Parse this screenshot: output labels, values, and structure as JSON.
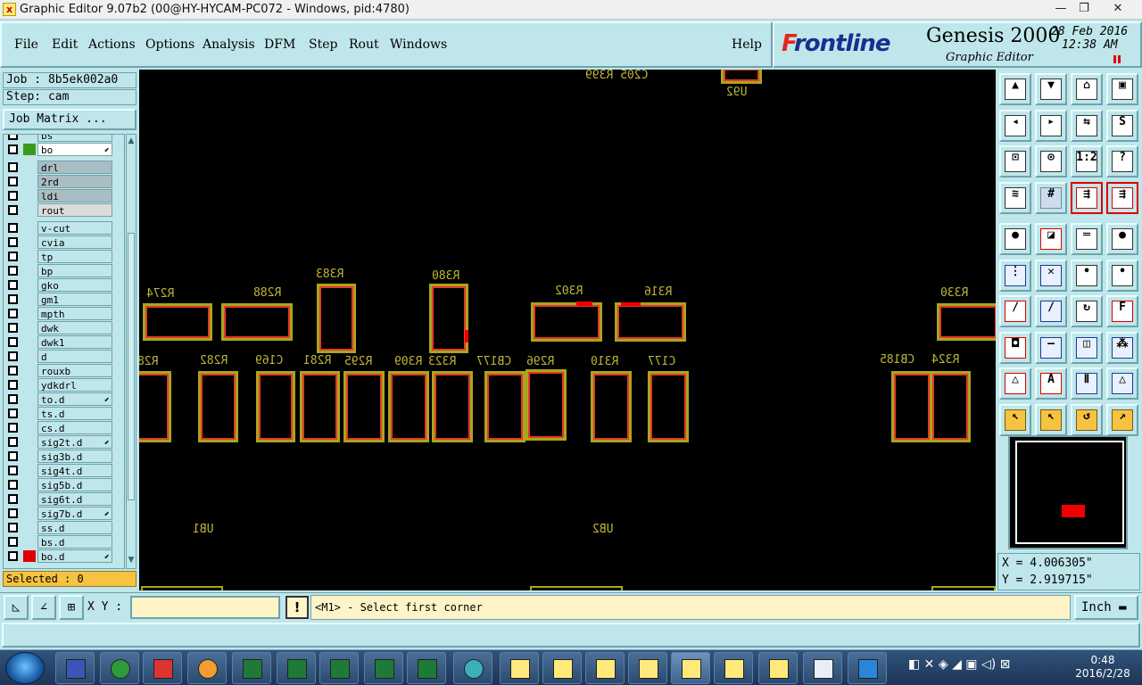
{
  "window": {
    "title": "Graphic Editor 9.07b2 (00@HY-HYCAM-PC072 - Windows, pid:4780)",
    "minimize": "—",
    "maximize": "❐",
    "close": "✕"
  },
  "menu": {
    "file": "File",
    "edit": "Edit",
    "actions": "Actions",
    "options": "Options",
    "analysis": "Analysis",
    "dfm": "DFM",
    "step": "Step",
    "rout": "Rout",
    "windows": "Windows",
    "help": "Help"
  },
  "brand": {
    "logo_first": "F",
    "logo_rest": "rontline",
    "product": "Genesis 2000",
    "subtitle": "Graphic Editor",
    "date": "28 Feb 2016",
    "time": "12:38 AM"
  },
  "job": {
    "job_line": "Job : 8b5ek002a0",
    "step_line": "Step: cam",
    "matrix_button": "Job Matrix ...",
    "selected": "Selected : 0"
  },
  "layers": [
    {
      "name": "bs"
    },
    {
      "name": "bo",
      "swatch": "#3a9a1a",
      "style": "white",
      "arrow": true
    },
    {
      "name": "drl",
      "style": "gray"
    },
    {
      "name": "2rd",
      "style": "gray"
    },
    {
      "name": "ldi",
      "style": "gray"
    },
    {
      "name": "rout",
      "style": "light"
    },
    {
      "name": "v-cut"
    },
    {
      "name": "cvia"
    },
    {
      "name": "tp"
    },
    {
      "name": "bp"
    },
    {
      "name": "gko"
    },
    {
      "name": "gm1"
    },
    {
      "name": "mpth"
    },
    {
      "name": "dwk"
    },
    {
      "name": "dwk1"
    },
    {
      "name": "d"
    },
    {
      "name": "rouxb"
    },
    {
      "name": "ydkdrl"
    },
    {
      "name": "to.d",
      "arrow": true
    },
    {
      "name": "ts.d"
    },
    {
      "name": "cs.d"
    },
    {
      "name": "sig2t.d",
      "arrow": true
    },
    {
      "name": "sig3b.d"
    },
    {
      "name": "sig4t.d"
    },
    {
      "name": "sig5b.d"
    },
    {
      "name": "sig6t.d"
    },
    {
      "name": "sig7b.d",
      "arrow": true
    },
    {
      "name": "ss.d"
    },
    {
      "name": "bs.d"
    },
    {
      "name": "bo.d",
      "swatch": "#e00000",
      "arrow": true
    }
  ],
  "canvas_labels": {
    "top1": "C205 R399",
    "top2": "U92",
    "r274": "R274",
    "r288": "R288",
    "r383": "R383",
    "r380": "R380",
    "r302": "R302",
    "r316": "R316",
    "r330": "R330",
    "r28x": "R28",
    "r282": "R282",
    "c169": "C169",
    "r281": "R281",
    "r295": "R295",
    "r309": "R309",
    "r323": "R323",
    "cb177": "CB177",
    "r296": "R296",
    "r310": "R310",
    "c177": "C177",
    "cb185": "CB185",
    "r324": "R324",
    "ub1": "UB1",
    "ub2": "UB2"
  },
  "coords": {
    "x": "X = 4.006305\"",
    "y": "Y = 2.919715\""
  },
  "bottom": {
    "xy_label": "X Y :",
    "xy_value": "",
    "warn": "!",
    "prompt": "<M1> - Select first corner",
    "unit": "Inch"
  },
  "taskbar": {
    "clock_time": "0:48",
    "clock_date": "2016/2/28"
  },
  "colors": {
    "panel": "#bfe6ea",
    "pad_outline": "#a8a61c",
    "pad_inner": "#e4382b",
    "selected_bar": "#f5c242"
  }
}
